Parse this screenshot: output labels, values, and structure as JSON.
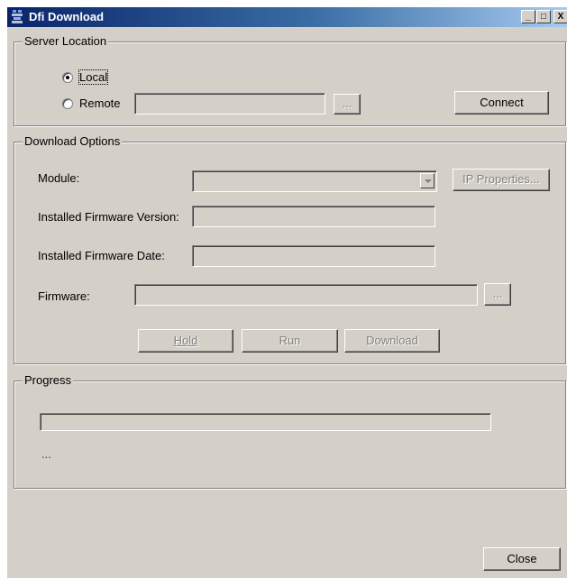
{
  "window": {
    "title": "Dfi Download",
    "controls": {
      "minimize": "_",
      "maximize": "□",
      "close": "X"
    }
  },
  "server_location": {
    "group_label": "Server Location",
    "local_label": "Local",
    "remote_label": "Remote",
    "selected": "Local",
    "remote_value": "",
    "browse_label": "...",
    "connect_label": "Connect"
  },
  "download_options": {
    "group_label": "Download Options",
    "module_label": "Module:",
    "module_value": "",
    "ip_properties_label": "IP Properties...",
    "installed_version_label": "Installed Firmware Version:",
    "installed_version_value": "",
    "installed_date_label": "Installed Firmware Date:",
    "installed_date_value": "",
    "firmware_label": "Firmware:",
    "firmware_value": "",
    "firmware_browse_label": "...",
    "hold_label": "Hold",
    "run_label": "Run",
    "download_label": "Download"
  },
  "progress": {
    "group_label": "Progress",
    "fraction": 0,
    "status_text": "..."
  },
  "close_label": "Close"
}
